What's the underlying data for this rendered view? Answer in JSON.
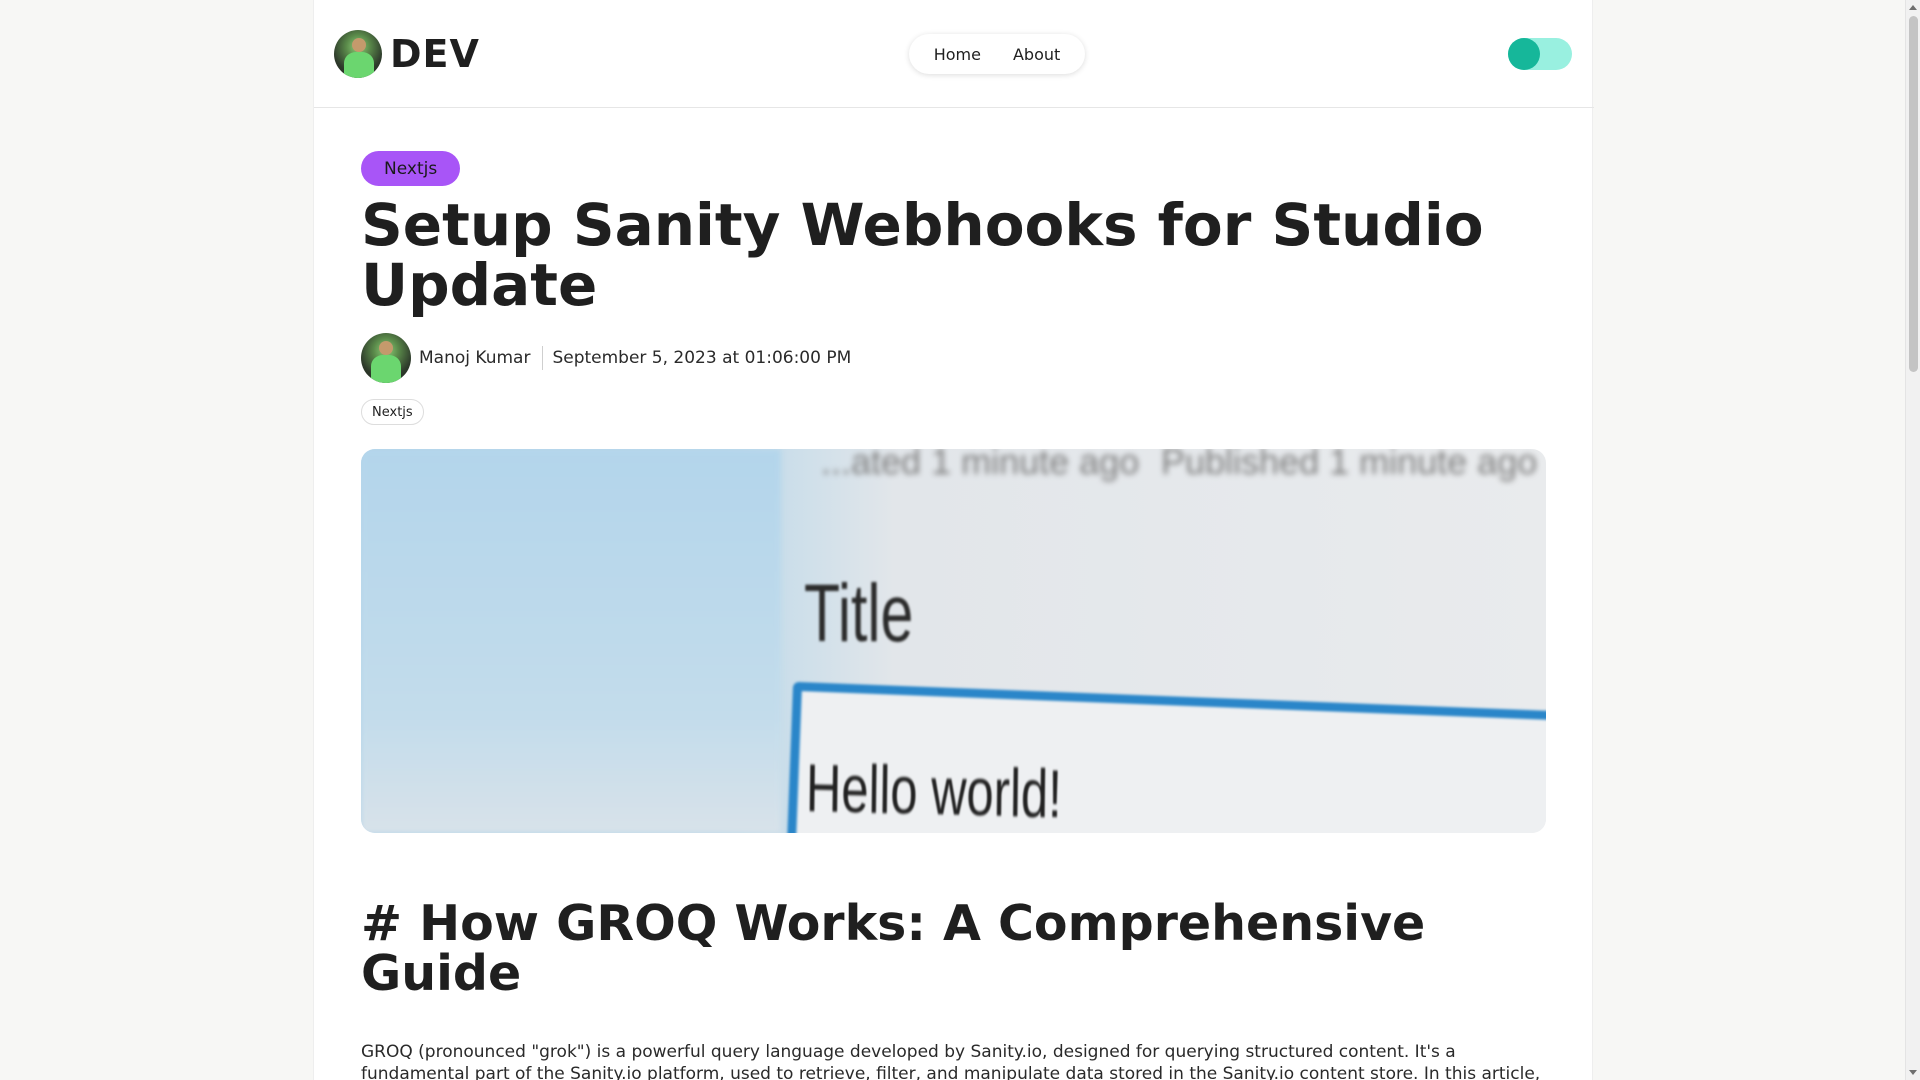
{
  "header": {
    "brand": "DEV",
    "nav": [
      {
        "label": "Home"
      },
      {
        "label": "About"
      }
    ],
    "theme_toggle": {
      "state": "on",
      "accent": "#16b79a"
    }
  },
  "article": {
    "category": "Nextjs",
    "title": "Setup Sanity Webhooks for Studio Update",
    "author": "Manoj Kumar",
    "date": "September 5, 2023 at 01:06:00 PM",
    "tags": [
      "Nextjs"
    ],
    "hero_image": {
      "faded_left": "...ated 1 minute ago",
      "faded_right": "Published 1 minute ago",
      "field_label": "Title",
      "field_value": "Hello world!"
    },
    "heading": "# How GROQ Works: A Comprehensive Guide",
    "paragraph": "GROQ (pronounced \"grok\") is a powerful query language developed by Sanity.io, designed for querying structured content. It's a fundamental part of the Sanity.io platform, used to retrieve, filter, and manipulate data stored in the Sanity.io content store. In this article, we'll dive into the world of GROQ"
  },
  "colors": {
    "category_pill": "#a855f7",
    "toggle_track": "#99f0e0",
    "toggle_knob": "#16b79a"
  }
}
